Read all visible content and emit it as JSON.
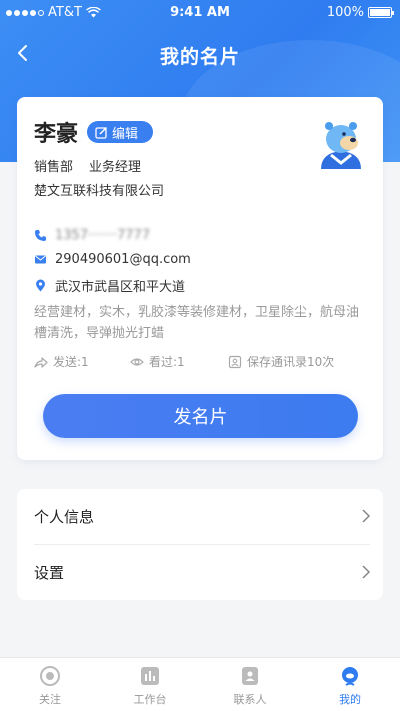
{
  "status_bar": {
    "carrier": "AT&T",
    "time": "9:41 AM",
    "battery": "100%"
  },
  "nav": {
    "title": "我的名片"
  },
  "card": {
    "name": "李豪",
    "edit_label": "编辑",
    "department": "销售部",
    "position": "业务经理",
    "company": "楚文互联科技有限公司",
    "phone": "1357·······7777",
    "email": "290490601@qq.com",
    "address": "武汉市武昌区和平大道",
    "tags": "经营建材，实木，乳胶漆等装修建材，卫星除尘，航母油槽清洗，导弹抛光打蜡",
    "stats": {
      "sent": "发送:1",
      "viewed": "看过:1",
      "saved": "保存通讯录10次"
    },
    "send_button": "发名片"
  },
  "menu": {
    "personal_info": "个人信息",
    "settings": "设置"
  },
  "tabs": [
    {
      "label": "关注",
      "icon": "focus-icon"
    },
    {
      "label": "工作台",
      "icon": "workbench-icon"
    },
    {
      "label": "联系人",
      "icon": "contacts-icon"
    },
    {
      "label": "我的",
      "icon": "mine-icon"
    }
  ],
  "colors": {
    "primary": "#2f7cf0",
    "background": "#f4f5f7"
  }
}
